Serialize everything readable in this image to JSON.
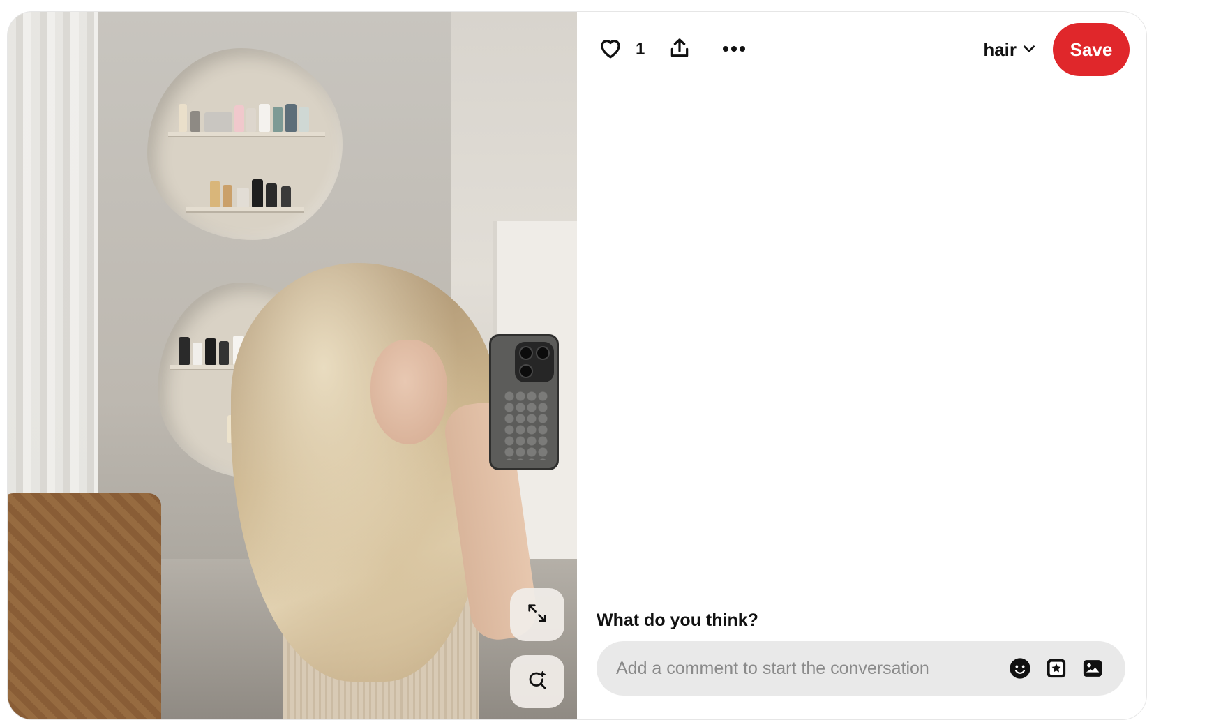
{
  "pin": {
    "image_alt": "Woman with long wavy blonde hair taking a mirror selfie in a salon",
    "like_count": "1",
    "board_name": "hair",
    "save_label": "Save"
  },
  "icons": {
    "like": "heart-icon",
    "share": "share-icon",
    "more": "more-dots-icon",
    "board": "chevron-down-icon",
    "expand": "expand-icon",
    "visual_search": "visual-search-icon",
    "emoji": "emoji-icon",
    "sticker": "sticker-icon",
    "photo": "photo-icon"
  },
  "comments": {
    "heading": "What do you think?",
    "placeholder": "Add a comment to start the conversation"
  },
  "colors": {
    "save_button": "#e0272b",
    "comment_bar": "#e9e9e9"
  }
}
